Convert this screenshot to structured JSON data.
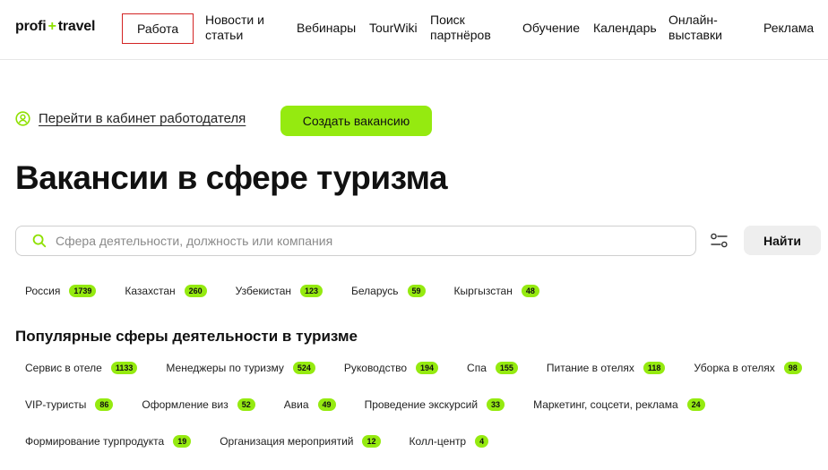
{
  "header": {
    "logo_left": "profi",
    "logo_plus": "+",
    "logo_right": "travel",
    "nav": [
      {
        "label": "Работа"
      },
      {
        "label": "Новости и"
      },
      {
        "label": "статьи"
      },
      {
        "label": "Вебинары"
      },
      {
        "label": "TourWiki"
      },
      {
        "label": "Поиск"
      },
      {
        "label": "партнёров"
      },
      {
        "label": "Обучение"
      },
      {
        "label": "Календарь"
      },
      {
        "label": "Онлайн-"
      },
      {
        "label": "выставки"
      },
      {
        "label": "Реклама"
      }
    ]
  },
  "employer": {
    "link_label": "Перейти в кабинет работодателя",
    "create_label": "Создать вакансию"
  },
  "page_title": "Вакансии в сфере туризма",
  "search": {
    "placeholder": "Сфера деятельности, должность или компания",
    "value": "",
    "find_label": "Найти"
  },
  "countries": [
    {
      "name": "Россия",
      "count": "1739"
    },
    {
      "name": "Казахстан",
      "count": "260"
    },
    {
      "name": "Узбекистан",
      "count": "123"
    },
    {
      "name": "Беларусь",
      "count": "59"
    },
    {
      "name": "Кыргызстан",
      "count": "48"
    }
  ],
  "popular_title": "Популярные сферы деятельности в туризме",
  "spheres_row1": [
    {
      "name": "Сервис в отеле",
      "count": "1133"
    },
    {
      "name": "Менеджеры по туризму",
      "count": "524"
    },
    {
      "name": "Руководство",
      "count": "194"
    },
    {
      "name": "Спа",
      "count": "155"
    },
    {
      "name": "Питание в отелях",
      "count": "118"
    },
    {
      "name": "Уборка в отелях",
      "count": "98"
    }
  ],
  "spheres_row2": [
    {
      "name": "VIP-туристы",
      "count": "86"
    },
    {
      "name": "Оформление виз",
      "count": "52"
    },
    {
      "name": "Авиа",
      "count": "49"
    },
    {
      "name": "Проведение экскурсий",
      "count": "33"
    },
    {
      "name": "Маркетинг, соцсети, реклама",
      "count": "24"
    }
  ],
  "spheres_row3": [
    {
      "name": "Формирование турпродукта",
      "count": "19"
    },
    {
      "name": "Организация мероприятий",
      "count": "12"
    },
    {
      "name": "Колл-центр",
      "count": "4"
    }
  ],
  "colors": {
    "accent": "#95ea10",
    "active_border": "#d32424"
  },
  "icons": {
    "user": "user-circle-icon",
    "search": "search-icon",
    "filter": "filter-sliders-icon"
  }
}
